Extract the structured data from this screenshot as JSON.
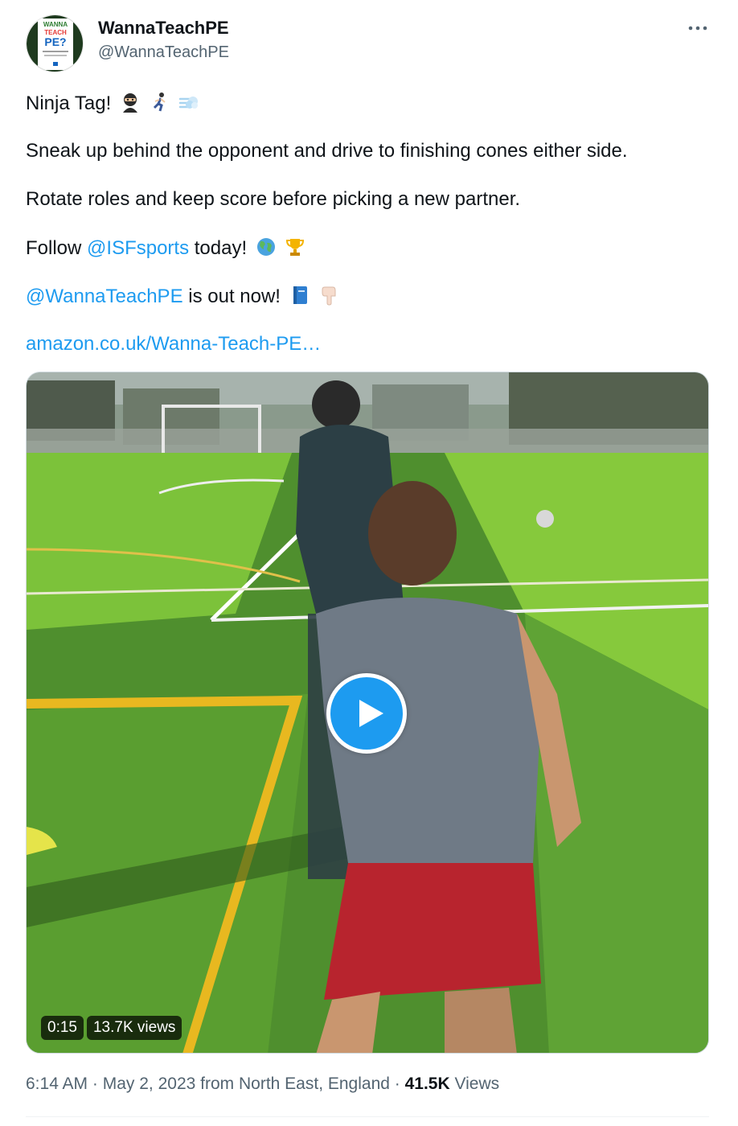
{
  "author": {
    "name": "WannaTeachPE",
    "handle": "@WannaTeachPE",
    "avatar_text": [
      "WANNA",
      "TEACH",
      "PE?"
    ]
  },
  "tweet": {
    "line1": "Ninja Tag!",
    "line1_emojis": [
      "ninja-emoji",
      "runner-emoji",
      "dash-emoji"
    ],
    "line2": "Sneak up behind the opponent and drive to finishing cones either side.",
    "line3": "Rotate roles and keep score before picking a new partner.",
    "line4_prefix": "Follow ",
    "line4_mention": "@ISFsports",
    "line4_suffix": " today!",
    "line4_emojis": [
      "globe-emoji",
      "trophy-emoji"
    ],
    "line5_mention": "@WannaTeachPE",
    "line5_suffix": " is out now!",
    "line5_emojis": [
      "book-emoji",
      "pointing-down-emoji"
    ],
    "line6_link": "amazon.co.uk/Wanna-Teach-PE…"
  },
  "video": {
    "duration": "0:15",
    "views": "13.7K views"
  },
  "meta": {
    "time": "6:14 AM",
    "sep1": " · ",
    "date": "May 2, 2023",
    "location": " from North East, England",
    "sep2": " · ",
    "views_count": "41.5K",
    "views_label": " Views"
  },
  "colors": {
    "link": "#1d9bf0",
    "text": "#0f1419",
    "secondary": "#536471",
    "play_button": "#1d9bf0"
  }
}
